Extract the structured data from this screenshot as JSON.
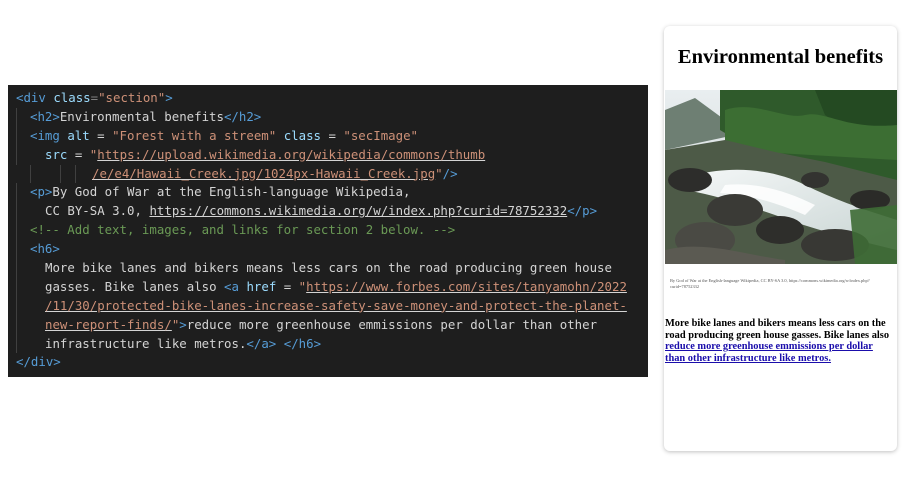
{
  "code_lines": [
    {
      "indent": 0,
      "guides": 0,
      "tokens": [
        [
          "tag",
          "<div "
        ],
        [
          "attr",
          "class"
        ],
        [
          "punct",
          "="
        ],
        [
          "str",
          "\"section\""
        ],
        [
          "tag",
          ">"
        ]
      ]
    },
    {
      "indent": 1,
      "guides": 1,
      "tokens": [
        [
          "tag",
          "<h2>"
        ],
        [
          "text",
          "Environmental benefits"
        ],
        [
          "tag",
          "</h2>"
        ]
      ]
    },
    {
      "indent": 1,
      "guides": 1,
      "tokens": [
        [
          "tag",
          "<img "
        ],
        [
          "attr",
          "alt"
        ],
        [
          "text",
          " = "
        ],
        [
          "str",
          "\"Forest with a streem\""
        ],
        [
          "text",
          " "
        ],
        [
          "attr",
          "class"
        ],
        [
          "text",
          " = "
        ],
        [
          "str",
          "\"secImage\""
        ]
      ]
    },
    {
      "indent": 2,
      "guides": 1,
      "tokens": [
        [
          "attr",
          "src"
        ],
        [
          "text",
          " = "
        ],
        [
          "str",
          "\""
        ],
        [
          "strlink",
          "https://upload.wikimedia.org/wikipedia/commons/thumb"
        ]
      ]
    },
    {
      "indent": 3,
      "guides": 3,
      "tokens": [
        [
          "strlink",
          "/e/e4/Hawaii_Creek.jpg/1024px-Hawaii_Creek.jpg"
        ],
        [
          "str",
          "\""
        ],
        [
          "tag",
          "/>"
        ]
      ]
    },
    {
      "indent": 1,
      "guides": 1,
      "tokens": [
        [
          "tag",
          "<p>"
        ],
        [
          "text",
          "By God of War at the English-language Wikipedia,"
        ]
      ]
    },
    {
      "indent": 2,
      "guides": 1,
      "tokens": [
        [
          "text",
          "CC BY-SA 3.0, "
        ],
        [
          "textlink",
          "https://commons.wikimedia.org/w/index.php?curid=78752332"
        ],
        [
          "tag",
          "</p>"
        ]
      ]
    },
    {
      "indent": 1,
      "guides": 1,
      "tokens": [
        [
          "comment",
          "<!-- Add text, images, and links for section 2 below. -->"
        ]
      ]
    },
    {
      "indent": 1,
      "guides": 1,
      "tokens": [
        [
          "tag",
          "<h6>"
        ]
      ]
    },
    {
      "indent": 2,
      "guides": 1,
      "tokens": [
        [
          "text",
          "More bike lanes and bikers means less cars on the road producing green house"
        ]
      ]
    },
    {
      "indent": 2,
      "guides": 1,
      "tokens": [
        [
          "text",
          "gasses. Bike lanes also "
        ],
        [
          "tag",
          "<a "
        ],
        [
          "attr",
          "href"
        ],
        [
          "text",
          " = "
        ],
        [
          "str",
          "\""
        ],
        [
          "strlink",
          "https://www.forbes.com/sites/tanyamohn/2022"
        ]
      ]
    },
    {
      "indent": 2,
      "guides": 1,
      "tokens": [
        [
          "strlink",
          "/11/30/protected-bike-lanes-increase-safety-save-money-and-protect-the-planet-"
        ]
      ]
    },
    {
      "indent": 2,
      "guides": 1,
      "tokens": [
        [
          "strlink",
          "new-report-finds/"
        ],
        [
          "str",
          "\""
        ],
        [
          "tag",
          ">"
        ],
        [
          "text",
          "reduce more greenhouse emmissions per dollar than other"
        ]
      ]
    },
    {
      "indent": 2,
      "guides": 1,
      "tokens": [
        [
          "text",
          "infrastructure like metros."
        ],
        [
          "tag",
          "</a>"
        ],
        [
          "text",
          " "
        ],
        [
          "tag",
          "</h6>"
        ]
      ]
    },
    {
      "indent": 0,
      "guides": 0,
      "tokens": [
        [
          "tag",
          "</div>"
        ]
      ]
    }
  ],
  "preview": {
    "heading": "Environmental benefits",
    "image_alt": "Forest with a streem",
    "caption": "By God of War at the English-language Wikipedia, CC BY-SA 3.0, https://commons.wikimedia.org/w/index.php?curid=78752332",
    "h6_text": "More bike lanes and bikers means less cars on the road producing green house gasses. Bike lanes also ",
    "h6_link": "reduce more greenhouse emmissions per dollar than other infrastructure like metros."
  },
  "colors": {
    "editor_bg": "#1e1e1e",
    "tag": "#569cd6",
    "attr": "#9cdcfe",
    "string": "#ce9178",
    "comment": "#6a9955",
    "text": "#d4d4d4",
    "link": "#1a0dab"
  }
}
